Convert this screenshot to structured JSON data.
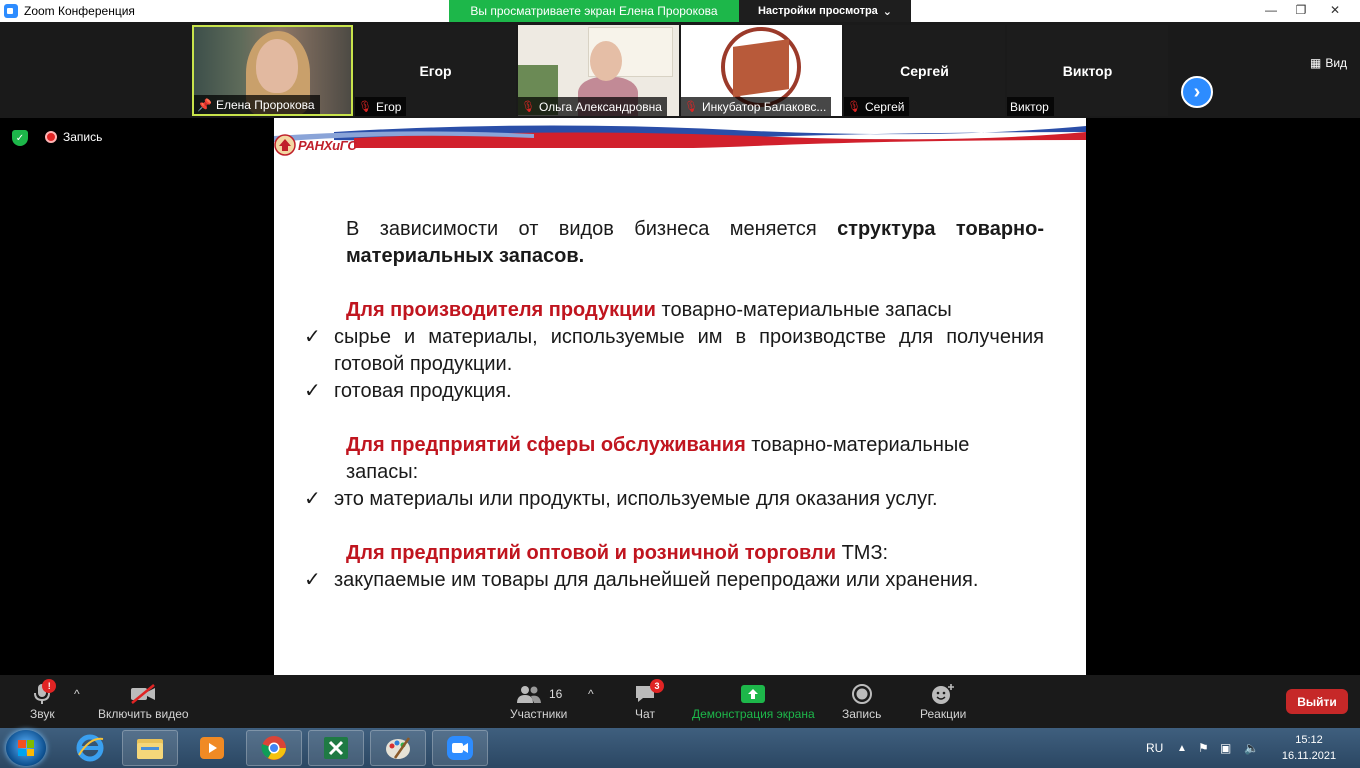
{
  "window": {
    "title": "Zoom Конференция",
    "share_banner": "Вы просматриваете экран Елена Пророкова",
    "view_options": "Настройки просмотра"
  },
  "gallery": {
    "participants": [
      {
        "name": "Елена Пророкова",
        "pinned": true,
        "muted": false
      },
      {
        "name": "Егор",
        "muted": true
      },
      {
        "name": "Ольга Александровна",
        "muted": true
      },
      {
        "name": "Инкубатор Балаковс...",
        "muted": true
      },
      {
        "name": "Сергей",
        "muted": true
      },
      {
        "name": "Виктор",
        "muted": false
      }
    ],
    "view_label": "Вид"
  },
  "recording": {
    "label": "Запись"
  },
  "slide": {
    "logo_text": "РАНХиГС",
    "p1_a": "В зависимости от ",
    "p1_b": "видов бизнеса",
    "p1_c": " меняется ",
    "p1_d": "структура товарно- материальных запасов.",
    "s1_head": "Для производителя продукции",
    "s1_tail": " товарно-материальные запасы",
    "s1_item1": "сырье и материалы, используемые им в производстве для получения готовой продукции.",
    "s1_item2": "готовая  продукция.",
    "s2_head": "Для предприятий сферы обслуживания",
    "s2_tail": " товарно-материальные запасы:",
    "s2_item1": "это материалы или продукты, используемые для оказания услуг.",
    "s3_head": "Для предприятий оптовой и розничной торговли",
    "s3_tail": " ТМЗ:",
    "s3_item1": "закупаемые им товары для дальнейшей перепродажи или хранения.",
    "check": "✓"
  },
  "toolbar": {
    "audio": "Звук",
    "video": "Включить видео",
    "participants": "Участники",
    "participants_count": "16",
    "chat": "Чат",
    "chat_badge": "3",
    "share": "Демонстрация экрана",
    "record": "Запись",
    "reactions": "Реакции",
    "leave": "Выйти"
  },
  "taskbar": {
    "lang": "RU",
    "time": "15:12",
    "date": "16.11.2021"
  }
}
